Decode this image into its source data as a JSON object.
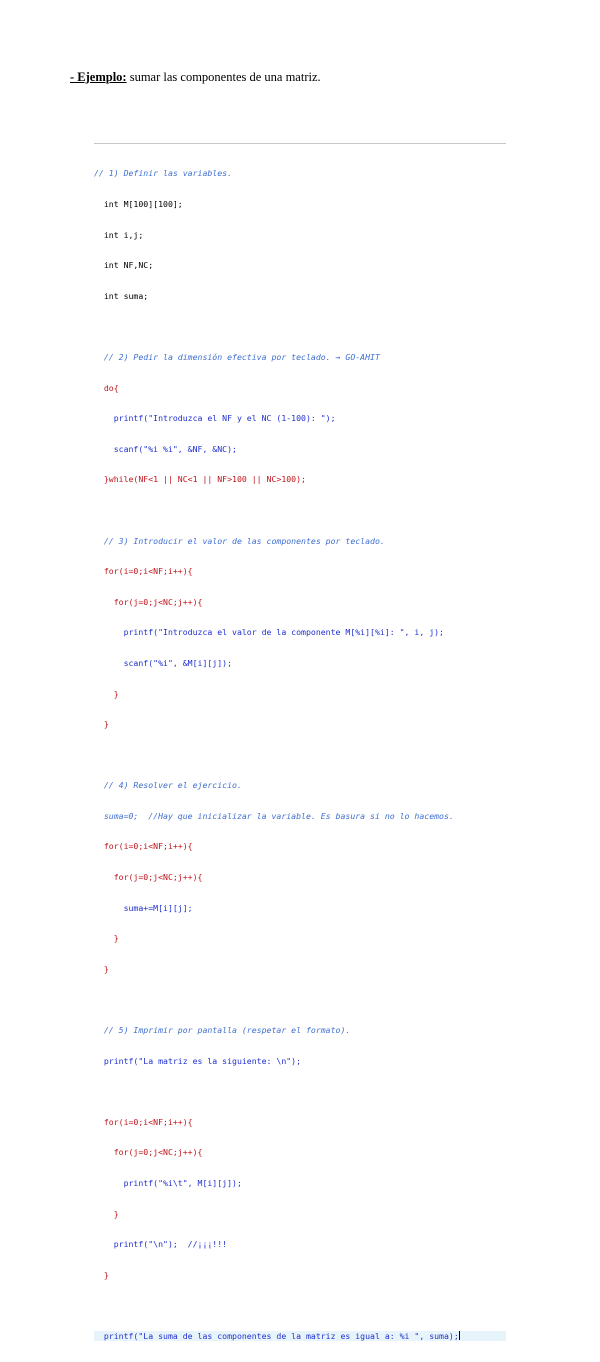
{
  "heading": {
    "lead": "- Ejemplo:",
    "rest": " sumar las componentes de una matriz."
  },
  "code_lines": [
    "// 1) Definir las variables.",
    "  int M[100][100];",
    "  int i,j;",
    "  int NF,NC;",
    "  int suma;",
    "",
    "  // 2) Pedir la dimensión efectiva por teclado. → GO-AHIT",
    "  do{",
    "    printf(\"Introduzca el NF y el NC (1-100): \");",
    "    scanf(\"%i %i\", &NF, &NC);",
    "  }while(NF<1 || NC<1 || NF>100 || NC>100);",
    "",
    "  // 3) Introducir el valor de las componentes por teclado.",
    "  for(i=0;i<NF;i++){",
    "    for(j=0;j<NC;j++){",
    "      printf(\"Introduzca el valor de la componente M[%i][%i]: \", i, j);",
    "      scanf(\"%i\", &M[i][j]);",
    "    }",
    "  }",
    "",
    "  // 4) Resolver el ejercicio.",
    "  suma=0;  //Hay que inicializar la variable. Es basura si no lo hacemos.",
    "  for(i=0;i<NF;i++){",
    "    for(j=0;j<NC;j++){",
    "      suma+=M[i][j];",
    "    }",
    "  }",
    "",
    "  // 5) Imprimir por pantalla (respetar el formato).",
    "  printf(\"La matriz es la siguiente: \\n\");",
    "",
    "  for(i=0;i<NF;i++){",
    "    for(j=0;j<NC;j++){",
    "      printf(\"%i\\t\", M[i][j]);",
    "    }",
    "    printf(\"\\n\");  //¡¡¡!!!",
    "  }",
    "",
    "  printf(\"La suma de las componentes de la matriz es igual a: %i \", suma);"
  ]
}
